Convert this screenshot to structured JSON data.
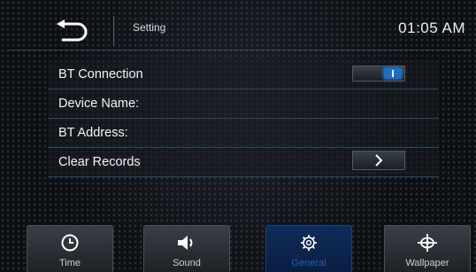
{
  "header": {
    "title": "Setting",
    "time": "01:05 AM",
    "back_icon": "back-arrow-icon"
  },
  "settings": {
    "rows": [
      {
        "label": "BT Connection",
        "control": "toggle",
        "state": "on"
      },
      {
        "label": "Device Name:"
      },
      {
        "label": "BT Address:"
      },
      {
        "label": "Clear Records",
        "control": "arrow"
      }
    ]
  },
  "tabs": [
    {
      "label": "Time",
      "icon": "clock-icon",
      "active": false
    },
    {
      "label": "Sound",
      "icon": "speaker-icon",
      "active": false
    },
    {
      "label": "General",
      "icon": "gear-icon",
      "active": true
    },
    {
      "label": "Wallpaper",
      "icon": "wallpaper-icon",
      "active": false
    }
  ],
  "colors": {
    "accent": "#1f6cc4",
    "active_tab": "#0f2c5a"
  }
}
